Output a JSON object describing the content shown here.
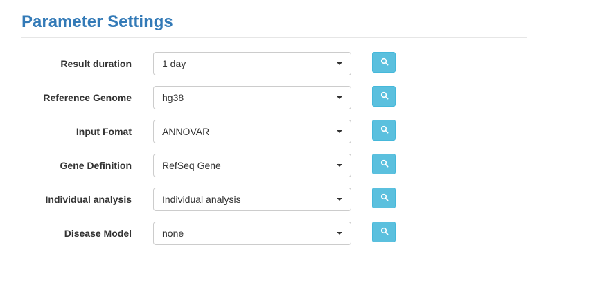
{
  "page": {
    "title": "Parameter Settings"
  },
  "colors": {
    "title": "#337ab7",
    "info_button": "#5bc0de",
    "info_button_border": "#46b8da"
  },
  "fields": [
    {
      "label": "Result duration",
      "value": "1 day",
      "button_icon": "search-icon"
    },
    {
      "label": "Reference Genome",
      "value": "hg38",
      "button_icon": "search-icon"
    },
    {
      "label": "Input Fomat",
      "value": "ANNOVAR",
      "button_icon": "search-icon"
    },
    {
      "label": "Gene Definition",
      "value": "RefSeq Gene",
      "button_icon": "search-icon"
    },
    {
      "label": "Individual analysis",
      "value": "Individual analysis",
      "button_icon": "search-icon"
    },
    {
      "label": "Disease Model",
      "value": "none",
      "button_icon": "search-icon"
    }
  ]
}
